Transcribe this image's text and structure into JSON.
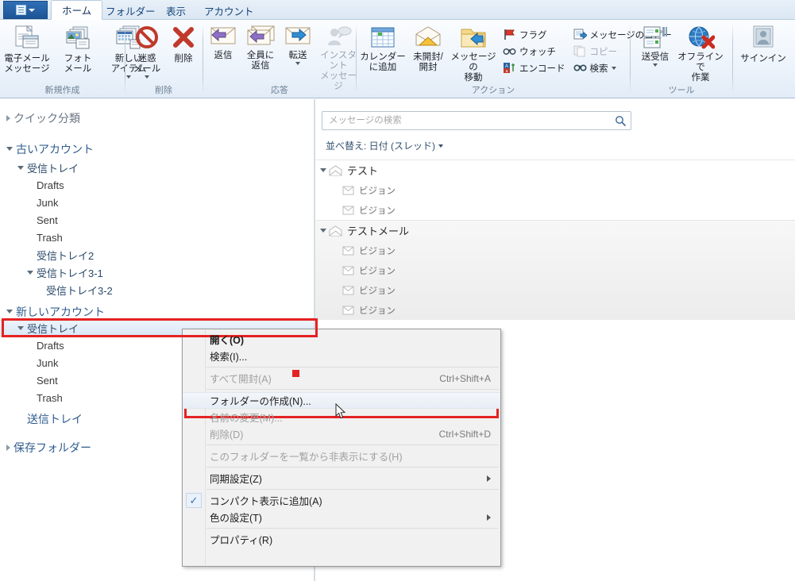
{
  "window": {
    "app_menu_icon": "document-menu-icon"
  },
  "tabs": [
    {
      "label": "ホーム",
      "active": true
    },
    {
      "label": "フォルダー",
      "active": false
    },
    {
      "label": "表示",
      "active": false
    },
    {
      "label": "アカウント",
      "active": false
    }
  ],
  "ribbon": {
    "groups": [
      {
        "name": "新規作成",
        "items": [
          {
            "label": "電子メール\nメッセージ",
            "icon": "new-email-icon",
            "dropdown": false,
            "disabled": false
          },
          {
            "label": "フォト\nメール",
            "icon": "photo-mail-icon",
            "dropdown": false,
            "disabled": false
          },
          {
            "label": "新しい\nアイテム",
            "icon": "new-item-icon",
            "dropdown": true,
            "disabled": false
          }
        ]
      },
      {
        "name": "削除",
        "items": [
          {
            "label": "迷惑\nメール",
            "icon": "junk-mail-icon",
            "dropdown": true,
            "disabled": false
          },
          {
            "label": "削除",
            "icon": "delete-x-icon",
            "dropdown": false,
            "disabled": false
          }
        ]
      },
      {
        "name": "応答",
        "items": [
          {
            "label": "返信",
            "icon": "reply-icon",
            "dropdown": false,
            "disabled": false
          },
          {
            "label": "全員に\n返信",
            "icon": "reply-all-icon",
            "dropdown": false,
            "disabled": false
          },
          {
            "label": "転送",
            "icon": "forward-icon",
            "dropdown": true,
            "disabled": false
          },
          {
            "label": "インスタント\nメッセージ",
            "icon": "instant-message-icon",
            "dropdown": false,
            "disabled": true
          }
        ]
      },
      {
        "name": "アクション",
        "items": [
          {
            "label": "カレンダー\nに追加",
            "icon": "calendar-add-icon",
            "dropdown": false,
            "disabled": false
          },
          {
            "label": "未開封/\n開封",
            "icon": "unread-read-icon",
            "dropdown": false,
            "disabled": false
          },
          {
            "label": "メッセージの\n移動",
            "icon": "move-message-icon",
            "dropdown": false,
            "disabled": false
          }
        ],
        "small_items_col1": [
          {
            "label": "フラグ",
            "icon": "flag-icon",
            "disabled": false,
            "dropdown": false
          },
          {
            "label": "ウォッチ",
            "icon": "watch-icon",
            "disabled": false,
            "dropdown": false
          },
          {
            "label": "エンコード",
            "icon": "encode-icon",
            "disabled": false,
            "dropdown": false
          }
        ],
        "small_items_col2": [
          {
            "label": "メッセージのコピー",
            "icon": "copy-message-icon",
            "disabled": false,
            "dropdown": false
          },
          {
            "label": "コピー",
            "icon": "copy-icon",
            "disabled": true,
            "dropdown": false
          },
          {
            "label": "検索",
            "icon": "find-icon",
            "disabled": false,
            "dropdown": true
          }
        ]
      },
      {
        "name": "ツール",
        "items": [
          {
            "label": "送受信",
            "icon": "send-receive-icon",
            "dropdown": true,
            "disabled": false
          },
          {
            "label": "オフラインで\n作業",
            "icon": "work-offline-icon",
            "dropdown": false,
            "disabled": false
          }
        ]
      },
      {
        "name": "",
        "items": [
          {
            "label": "サインイン",
            "icon": "sign-in-icon",
            "dropdown": false,
            "disabled": false
          }
        ]
      }
    ]
  },
  "sidebar": {
    "quick_views": {
      "label": "クイック分類",
      "expander": "closed"
    },
    "accounts": [
      {
        "label": "古いアカウント",
        "expander": "open",
        "folders": [
          {
            "label": "受信トレイ",
            "indent": 1,
            "expander": "open",
            "kind": "jp"
          },
          {
            "label": "Drafts",
            "indent": 2,
            "expander": "none",
            "kind": "en"
          },
          {
            "label": "Junk",
            "indent": 2,
            "expander": "none",
            "kind": "en"
          },
          {
            "label": "Sent",
            "indent": 2,
            "expander": "none",
            "kind": "en"
          },
          {
            "label": "Trash",
            "indent": 2,
            "expander": "none",
            "kind": "en"
          },
          {
            "label": "受信トレイ2",
            "indent": 2,
            "expander": "none",
            "kind": "jp"
          },
          {
            "label": "受信トレイ3-1",
            "indent": 2,
            "expander": "open",
            "kind": "jp"
          },
          {
            "label": "受信トレイ3-2",
            "indent": 3,
            "expander": "none",
            "kind": "jp"
          }
        ]
      },
      {
        "label": "新しいアカウント",
        "expander": "open",
        "folders": [
          {
            "label": "受信トレイ",
            "indent": 1,
            "expander": "open",
            "kind": "jp",
            "selected": true
          },
          {
            "label": "Drafts",
            "indent": 2,
            "expander": "none",
            "kind": "en"
          },
          {
            "label": "Junk",
            "indent": 2,
            "expander": "none",
            "kind": "en"
          },
          {
            "label": "Sent",
            "indent": 2,
            "expander": "none",
            "kind": "en"
          },
          {
            "label": "Trash",
            "indent": 2,
            "expander": "none",
            "kind": "en"
          }
        ]
      }
    ],
    "outbox": {
      "label": "送信トレイ"
    },
    "storage_folders": {
      "label": "保存フォルダー",
      "expander": "closed"
    }
  },
  "search": {
    "placeholder": "メッセージの検索",
    "value": "",
    "icon": "search-icon"
  },
  "sort": {
    "label": "並べ替え: 日付 (スレッド)"
  },
  "messages": {
    "groups": [
      {
        "subject": "テスト",
        "expander": "open",
        "shaded": false,
        "children": [
          {
            "subject": "ビジョン"
          },
          {
            "subject": "ビジョン"
          }
        ]
      },
      {
        "subject": "テストメール",
        "expander": "open",
        "shaded": true,
        "children": [
          {
            "subject": "ビジョン"
          },
          {
            "subject": "ビジョン"
          },
          {
            "subject": "ビジョン"
          },
          {
            "subject": "ビジョン"
          }
        ]
      }
    ]
  },
  "context_menu": {
    "items": [
      {
        "label": "開く(O)",
        "accel": "",
        "disabled": false,
        "bold": true,
        "checked": false,
        "submenu": false,
        "highlighted": false
      },
      {
        "label": "検索(I)...",
        "accel": "",
        "disabled": false,
        "bold": false,
        "checked": false,
        "submenu": false,
        "highlighted": false
      },
      {
        "separator": true
      },
      {
        "label": "すべて開封(A)",
        "accel": "Ctrl+Shift+A",
        "disabled": true,
        "bold": false,
        "checked": false,
        "submenu": false,
        "highlighted": false
      },
      {
        "separator": true
      },
      {
        "label": "フォルダーの作成(N)...",
        "accel": "",
        "disabled": false,
        "bold": false,
        "checked": false,
        "submenu": false,
        "highlighted": true
      },
      {
        "label": "名前の変更(M)...",
        "accel": "",
        "disabled": true,
        "bold": false,
        "checked": false,
        "submenu": false,
        "highlighted": false
      },
      {
        "label": "削除(D)",
        "accel": "Ctrl+Shift+D",
        "disabled": true,
        "bold": false,
        "checked": false,
        "submenu": false,
        "highlighted": false
      },
      {
        "separator": true
      },
      {
        "label": "このフォルダーを一覧から非表示にする(H)",
        "accel": "",
        "disabled": true,
        "bold": false,
        "checked": false,
        "submenu": false,
        "highlighted": false
      },
      {
        "separator": true
      },
      {
        "label": "同期設定(Z)",
        "accel": "",
        "disabled": false,
        "bold": false,
        "checked": false,
        "submenu": true,
        "highlighted": false
      },
      {
        "separator": true
      },
      {
        "label": "コンパクト表示に追加(A)",
        "accel": "",
        "disabled": false,
        "bold": false,
        "checked": true,
        "submenu": false,
        "highlighted": false
      },
      {
        "label": "色の設定(T)",
        "accel": "",
        "disabled": false,
        "bold": false,
        "checked": false,
        "submenu": true,
        "highlighted": false
      },
      {
        "separator": true
      },
      {
        "label": "プロパティ(R)",
        "accel": "",
        "disabled": false,
        "bold": false,
        "checked": false,
        "submenu": false,
        "highlighted": false
      }
    ],
    "check_glyph": "✓"
  },
  "annotations": {
    "highlight_color": "#e52222",
    "boxes": [
      {
        "name": "selected-folder-highlight"
      },
      {
        "name": "create-folder-menu-highlight"
      }
    ],
    "marker": {
      "name": "red-square-marker"
    }
  }
}
